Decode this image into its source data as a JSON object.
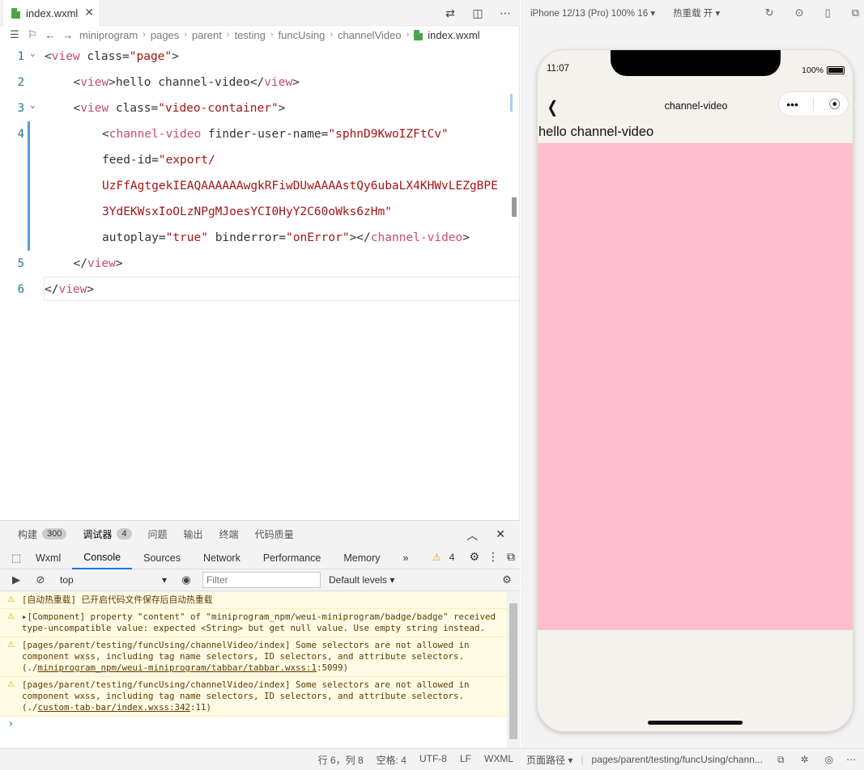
{
  "editor": {
    "tab_label": "index.wxml",
    "breadcrumb": [
      "miniprogram",
      "pages",
      "parent",
      "testing",
      "funcUsing",
      "channelVideo"
    ],
    "breadcrumb_current": "index.wxml",
    "lines": [
      {
        "no": "1",
        "fold": "⌄",
        "parts": [
          [
            "t-br",
            "<"
          ],
          [
            "t-tag2",
            "view"
          ],
          [
            "t-attr",
            " class="
          ],
          [
            "t-str",
            "\"page\""
          ],
          [
            "t-br",
            ">"
          ]
        ],
        "indent": 0
      },
      {
        "no": "2",
        "fold": "",
        "parts": [
          [
            "t-br",
            "<"
          ],
          [
            "t-tag2",
            "view"
          ],
          [
            "t-br",
            ">"
          ],
          [
            "t-pl",
            "hello channel-video"
          ],
          [
            "t-br",
            "</"
          ],
          [
            "t-tag2",
            "view"
          ],
          [
            "t-br",
            ">"
          ]
        ],
        "indent": 1
      },
      {
        "no": "3",
        "fold": "⌄",
        "parts": [
          [
            "t-br",
            "<"
          ],
          [
            "t-tag2",
            "view"
          ],
          [
            "t-attr",
            " class="
          ],
          [
            "t-str",
            "\"video-container\""
          ],
          [
            "t-br",
            ">"
          ]
        ],
        "indent": 1
      },
      {
        "no": "4",
        "fold": "",
        "parts": [
          [
            "t-br",
            "<"
          ],
          [
            "t-tag2",
            "channel-video"
          ],
          [
            "t-attr",
            " finder-user-name="
          ],
          [
            "t-str",
            "\"sphnD9KwoIZFtCv\""
          ]
        ],
        "indent": 2
      },
      {
        "no": "",
        "fold": "",
        "parts": [
          [
            "t-attr",
            "feed-id="
          ],
          [
            "t-str",
            "\"export/"
          ]
        ],
        "indent": 2
      },
      {
        "no": "",
        "fold": "",
        "parts": [
          [
            "t-str",
            "UzFfAgtgekIEAQAAAAAAwgkRFiwDUwAAAAstQy6ubaLX4KHWvLEZgBPE"
          ]
        ],
        "indent": 2
      },
      {
        "no": "",
        "fold": "",
        "parts": [
          [
            "t-str",
            "3YdEKWsxIoOLzNPgMJoesYCI0HyY2C60oWks6zHm\""
          ]
        ],
        "indent": 2
      },
      {
        "no": "",
        "fold": "",
        "parts": [
          [
            "t-attr",
            "autoplay="
          ],
          [
            "t-str",
            "\"true\""
          ],
          [
            "t-attr",
            " binderror="
          ],
          [
            "t-str",
            "\"onError\""
          ],
          [
            "t-br",
            "></"
          ],
          [
            "t-tag2",
            "channel-video"
          ],
          [
            "t-br",
            ">"
          ]
        ],
        "indent": 2
      },
      {
        "no": "5",
        "fold": "",
        "parts": [
          [
            "t-br",
            "</"
          ],
          [
            "t-tag2",
            "view"
          ],
          [
            "t-br",
            ">"
          ]
        ],
        "indent": 1
      },
      {
        "no": "6",
        "fold": "",
        "parts": [
          [
            "t-br",
            "</"
          ],
          [
            "t-tag2",
            "view"
          ],
          [
            "t-br",
            ">"
          ]
        ],
        "indent": 0
      }
    ]
  },
  "panel": {
    "tabs": [
      {
        "label": "构建",
        "badge": "300"
      },
      {
        "label": "调试器",
        "badge": "4"
      },
      {
        "label": "问题",
        "badge": ""
      },
      {
        "label": "输出",
        "badge": ""
      },
      {
        "label": "终端",
        "badge": ""
      },
      {
        "label": "代码质量",
        "badge": ""
      }
    ],
    "devtools_tabs": [
      "Wxml",
      "Console",
      "Sources",
      "Network",
      "Performance",
      "Memory"
    ],
    "more": "»",
    "warning_count": "4",
    "context": "top",
    "filter_placeholder": "Filter",
    "levels": "Default levels ▾",
    "messages": [
      {
        "html": "[自动热重载] 已开启代码文件保存后自动热重载"
      },
      {
        "html": "▸[Component] property \"content\" of \"miniprogram_npm/weui-miniprogram/badge/badge\" received type-uncompatible value: expected <String> but get null value. Use empty string instead."
      },
      {
        "html": "[pages/parent/testing/funcUsing/channelVideo/index] Some selectors are not allowed in component wxss, including tag name selectors, ID selectors, and attribute selectors.(./",
        "link": "miniprogram_npm/weui-miniprogram/tabbar/tabbar.wxss:1",
        "tail": ":5099)"
      },
      {
        "html": "[pages/parent/testing/funcUsing/channelVideo/index] Some selectors are not allowed in component wxss, including tag name selectors, ID selectors, and attribute selectors.(./",
        "link": "custom-tab-bar/index.wxss:342",
        "tail": ":11)"
      }
    ],
    "prompt": "›"
  },
  "status": {
    "position": "行 6，列 8",
    "spaces": "空格: 4",
    "encoding": "UTF-8",
    "eol": "LF",
    "lang": "WXML",
    "page_path_label": "页面路径 ▾",
    "page_path": "pages/parent/testing/funcUsing/chann..."
  },
  "simulator": {
    "device": "iPhone 12/13 (Pro) 100% 16 ▾",
    "hot_reload": "热重载 开 ▾",
    "time": "11:07",
    "battery": "100%",
    "nav_title": "channel-video",
    "capsule_more": "•••",
    "hello": "hello channel-video",
    "video_color": "#ffbfcf"
  }
}
